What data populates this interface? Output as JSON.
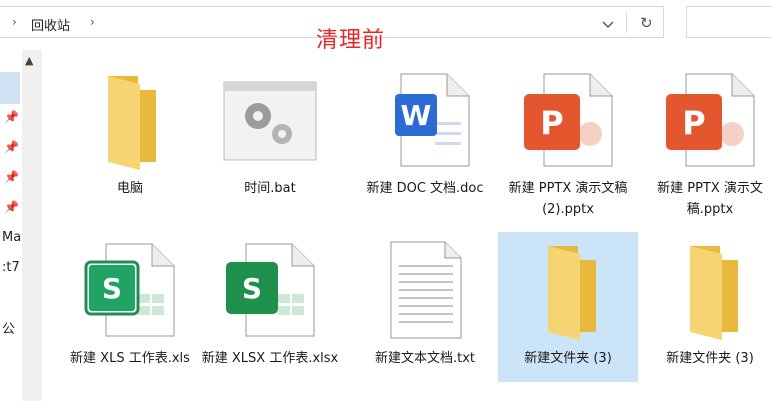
{
  "address": {
    "path": "回收站",
    "refresh_icon": "refresh-icon",
    "dropdown_icon": "chevron-down-icon"
  },
  "annotation": "清理前",
  "nav": {
    "fragments": [
      "Ma",
      ":t7",
      "公"
    ]
  },
  "files": [
    {
      "name": "电脑",
      "icon": "folder-icon"
    },
    {
      "name": "时间.bat",
      "icon": "batch-file-icon"
    },
    {
      "name": "新建 DOC 文档.doc",
      "icon": "word-doc-icon"
    },
    {
      "name": "新建 PPTX 演示文稿 (2).pptx",
      "icon": "powerpoint-icon"
    },
    {
      "name": "新建 PPTX 演示文稿.pptx",
      "icon": "powerpoint-icon"
    },
    {
      "name": "新建 XLS 工作表.xls",
      "icon": "excel-xls-icon"
    },
    {
      "name": "新建 XLSX 工作表.xlsx",
      "icon": "excel-xlsx-icon"
    },
    {
      "name": "新建文本文档.txt",
      "icon": "text-file-icon"
    },
    {
      "name": "新建文件夹 (3)",
      "icon": "folder-icon",
      "selected": true
    },
    {
      "name": "新建文件夹 (3)",
      "icon": "folder-icon"
    }
  ],
  "colors": {
    "annotation": "#e8262a",
    "selection": "#cce4f7",
    "folder": "#f4cd58",
    "word": "#2b6bd6",
    "powerpoint": "#e4572e",
    "excel": "#1f8f4e"
  }
}
